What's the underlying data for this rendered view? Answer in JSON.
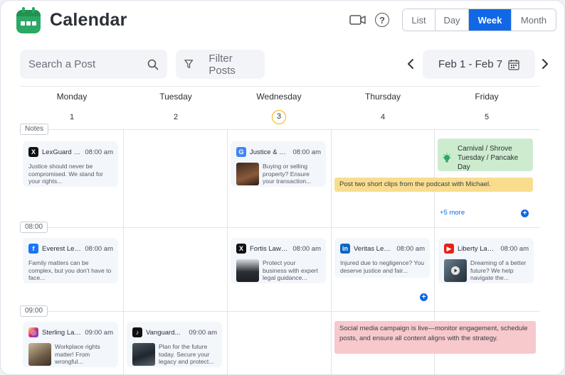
{
  "header": {
    "title": "Calendar",
    "video_icon": "video-camera-icon",
    "help_icon": "help-icon",
    "help_glyph": "?",
    "views": [
      "List",
      "Day",
      "Week",
      "Month"
    ],
    "active_view": "Week"
  },
  "toolbar": {
    "search_placeholder": "Search a Post",
    "filter_label": "Filter Posts",
    "date_range": "Feb 1 - Feb 7"
  },
  "days": [
    {
      "name": "Monday",
      "num": "1"
    },
    {
      "name": "Tuesday",
      "num": "2"
    },
    {
      "name": "Wednesday",
      "num": "3",
      "today": true
    },
    {
      "name": "Thursday",
      "num": "4"
    },
    {
      "name": "Friday",
      "num": "5"
    }
  ],
  "time_tags": [
    "Notes",
    "08:00",
    "09:00"
  ],
  "posts": {
    "mon_notes": {
      "source": "x",
      "account": "LexGuard Law",
      "time": "08:00 am",
      "text": "Justice should never be compromised. We stand for your rights..."
    },
    "wed_notes": {
      "source": "google-business",
      "account": "Justice & Par...",
      "time": "08:00 am",
      "text": "Buying or selling property? Ensure your transaction..."
    },
    "mon_08": {
      "source": "facebook",
      "account": "Everest Lega...",
      "time": "08:00 am",
      "text": "Family matters can be complex, but you don't have to face..."
    },
    "wed_08": {
      "source": "x",
      "account": "Fortis Law Firm",
      "time": "08:00 am",
      "text": "Protect your business with expert legal guidance..."
    },
    "thu_08": {
      "source": "linkedin",
      "account": "Veritas Legal...",
      "time": "08:00 am",
      "text": "Injured due to negligence? You deserve justice and fair..."
    },
    "fri_08": {
      "source": "youtube",
      "account": "Liberty Law...",
      "time": "08:00 am",
      "text": "Dreaming of a better future? We help navigate the..."
    },
    "mon_09": {
      "source": "instagram",
      "account": "Sterling Law...",
      "time": "09:00 am",
      "text": "Workplace rights matter! From wrongful..."
    },
    "tue_09": {
      "source": "tiktok",
      "account": "Vanguard...",
      "time": "09:00 am",
      "text": "Plan for the future today. Secure your legacy and protect..."
    }
  },
  "notes": {
    "holiday": "Carnival / Shrove Tuesday / Pancake Day",
    "podcast": "Post two short clips from the podcast with Michael.",
    "campaign": "Social media campaign is live—monitor engagement, schedule posts, and ensure all content aligns with the strategy."
  },
  "more_link": "+5 more",
  "colors": {
    "accent": "#1068e6",
    "logo": "#2aa866",
    "today_ring": "#f2b400",
    "note_green": "#cdeccf",
    "note_yellow": "#f9dd8f",
    "note_red": "#f7c9cc"
  }
}
